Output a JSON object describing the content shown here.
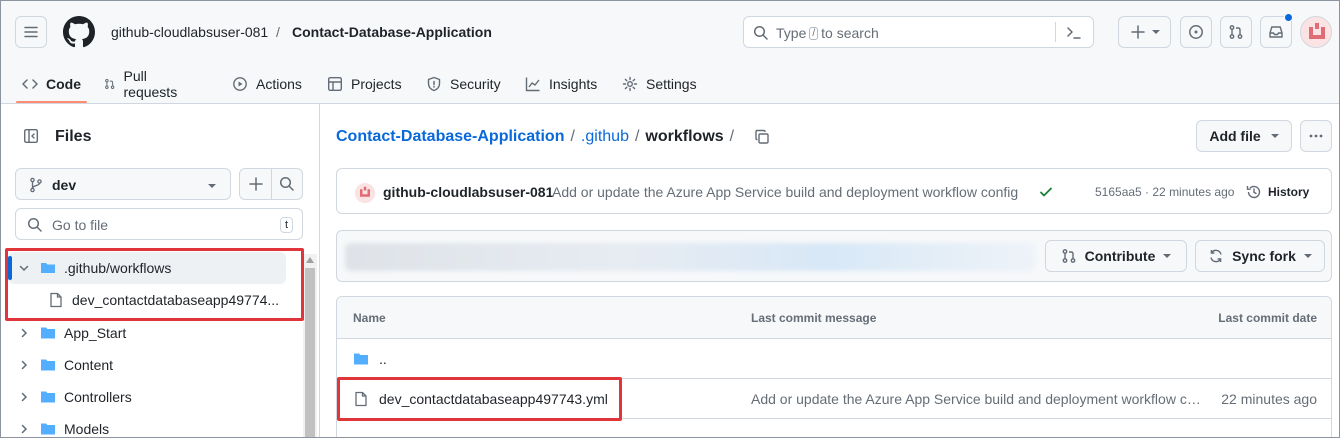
{
  "header": {
    "owner": "github-cloudlabsuser-081",
    "separator": "/",
    "repo": "Contact-Database-Application",
    "search_prefix": "Type",
    "search_key": "/",
    "search_suffix": "to search",
    "notification_color": "#0969da"
  },
  "tabs": [
    {
      "label": "Code",
      "icon": "code-icon",
      "selected": true
    },
    {
      "label": "Pull requests",
      "icon": "git-pull-request-icon"
    },
    {
      "label": "Actions",
      "icon": "play-icon"
    },
    {
      "label": "Projects",
      "icon": "table-icon"
    },
    {
      "label": "Security",
      "icon": "shield-icon"
    },
    {
      "label": "Insights",
      "icon": "graph-icon"
    },
    {
      "label": "Settings",
      "icon": "gear-icon"
    }
  ],
  "sidebar": {
    "title": "Files",
    "branch": "dev",
    "go_to_file_placeholder": "Go to file",
    "go_to_file_key": "t",
    "tree": [
      {
        "label": ".github/workflows",
        "type": "folder",
        "expanded": true,
        "active": true
      },
      {
        "label": "dev_contactdatabaseapp49774...",
        "type": "file"
      },
      {
        "label": "App_Start",
        "type": "folder"
      },
      {
        "label": "Content",
        "type": "folder"
      },
      {
        "label": "Controllers",
        "type": "folder"
      },
      {
        "label": "Models",
        "type": "folder"
      }
    ]
  },
  "breadcrumb": {
    "repo_link": "Contact-Database-Application",
    "sep1": "/",
    "github_link": ".github",
    "sep2": "/",
    "current": "workflows",
    "sep3": "/"
  },
  "actions": {
    "add_file": "Add file"
  },
  "latest_commit": {
    "author": "github-cloudlabsuser-081",
    "message": "Add or update the Azure App Service build and deployment workflow config",
    "sha_time": "5165aa5 · 22 minutes ago",
    "history_label": "History",
    "status_color": "#1a7f37"
  },
  "fork_bar": {
    "contribute": "Contribute",
    "sync_fork": "Sync fork"
  },
  "file_table": {
    "columns": [
      "Name",
      "Last commit message",
      "Last commit date"
    ],
    "parent_label": "..",
    "rows": [
      {
        "name": "dev_contactdatabaseapp497743.yml",
        "message": "Add or update the Azure App Service build and deployment workflow config",
        "date": "22 minutes ago"
      }
    ]
  },
  "colors": {
    "accent": "#0969da",
    "highlight_box": "#e0353b",
    "folder": "#54aeff",
    "tab_underline": "#fd8c73"
  }
}
